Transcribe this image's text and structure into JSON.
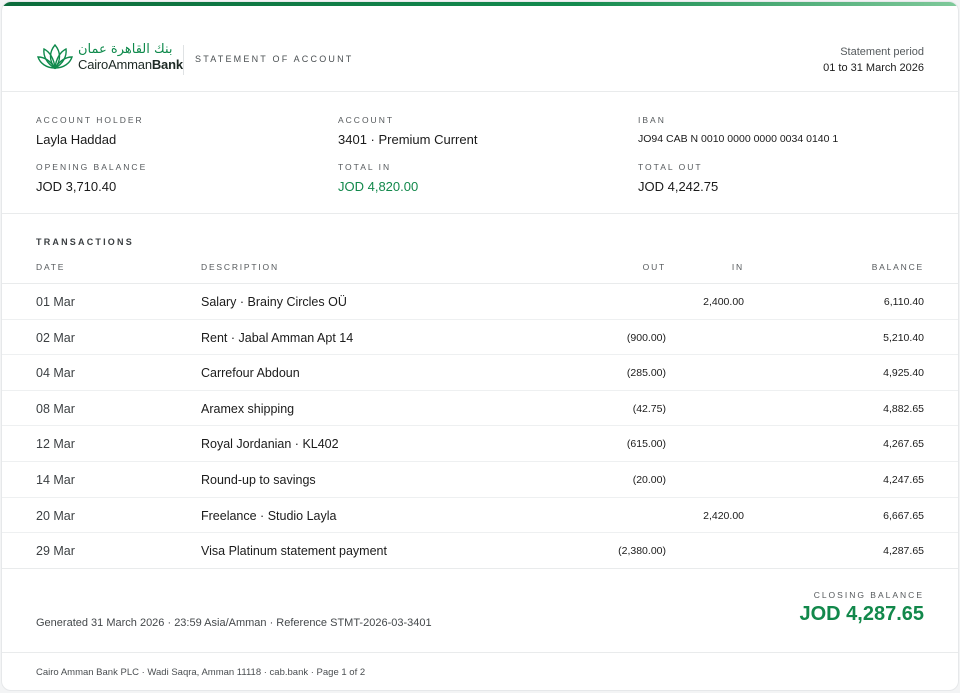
{
  "brand": {
    "arabic_name": "بنك القاهرة عمان",
    "name_prefix": "CairoAmman",
    "name_suffix": "Bank",
    "logo_icon": "lotus-icon",
    "accent_color": "#12884b"
  },
  "header": {
    "document_title": "STATEMENT OF ACCOUNT",
    "period_label": "Statement period",
    "period_value": "01 to 31 March 2026"
  },
  "summary": {
    "account_holder_label": "ACCOUNT HOLDER",
    "account_holder": "Layla Haddad",
    "account_label": "ACCOUNT",
    "account": "3401 · Premium Current",
    "iban_label": "IBAN",
    "iban": "JO94 CAB N 0010 0000 0000 0034 0140 1",
    "opening_balance_label": "OPENING BALANCE",
    "opening_balance": "JOD 3,710.40",
    "total_in_label": "TOTAL IN",
    "total_in": "JOD 4,820.00",
    "total_out_label": "TOTAL OUT",
    "total_out": "JOD 4,242.75"
  },
  "transactions": {
    "title": "TRANSACTIONS",
    "columns": {
      "date": "DATE",
      "description": "DESCRIPTION",
      "out": "OUT",
      "in": "IN",
      "balance": "BALANCE"
    },
    "rows": [
      {
        "date": "01 Mar",
        "description": "Salary · Brainy Circles OÜ",
        "out": "",
        "in": "2,400.00",
        "balance": "6,110.40"
      },
      {
        "date": "02 Mar",
        "description": "Rent · Jabal Amman Apt 14",
        "out": "(900.00)",
        "in": "",
        "balance": "5,210.40"
      },
      {
        "date": "04 Mar",
        "description": "Carrefour Abdoun",
        "out": "(285.00)",
        "in": "",
        "balance": "4,925.40"
      },
      {
        "date": "08 Mar",
        "description": "Aramex shipping",
        "out": "(42.75)",
        "in": "",
        "balance": "4,882.65"
      },
      {
        "date": "12 Mar",
        "description": "Royal Jordanian · KL402",
        "out": "(615.00)",
        "in": "",
        "balance": "4,267.65"
      },
      {
        "date": "14 Mar",
        "description": "Round-up to savings",
        "out": "(20.00)",
        "in": "",
        "balance": "4,247.65"
      },
      {
        "date": "20 Mar",
        "description": "Freelance · Studio Layla",
        "out": "",
        "in": "2,420.00",
        "balance": "6,667.65"
      },
      {
        "date": "29 Mar",
        "description": "Visa Platinum statement payment",
        "out": "(2,380.00)",
        "in": "",
        "balance": "4,287.65"
      }
    ]
  },
  "closing": {
    "generated": "Generated 31 March 2026 · 23:59 Asia/Amman · Reference STMT-2026-03-3401",
    "closing_label": "CLOSING BALANCE",
    "closing_value": "JOD 4,287.65"
  },
  "footer": {
    "text": "Cairo Amman Bank PLC · Wadi Saqra, Amman 11118 · cab.bank · Page 1 of 2"
  }
}
